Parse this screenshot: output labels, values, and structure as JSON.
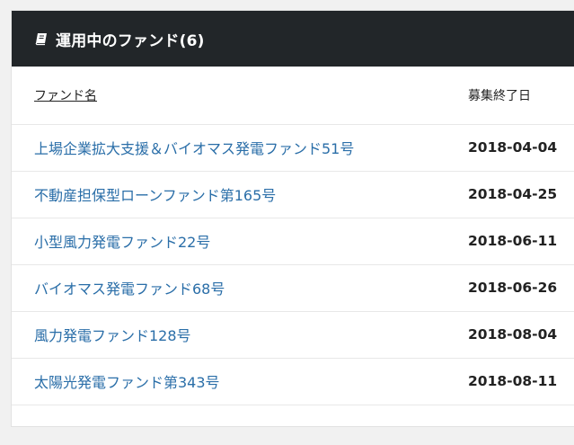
{
  "header": {
    "icon": "book-icon",
    "title": "運用中のファンド(6)"
  },
  "table": {
    "columns": {
      "name": "ファンド名",
      "date": "募集終了日"
    },
    "rows": [
      {
        "name": "上場企業拡大支援＆バイオマス発電ファンド51号",
        "date": "2018-04-04"
      },
      {
        "name": "不動産担保型ローンファンド第165号",
        "date": "2018-04-25"
      },
      {
        "name": "小型風力発電ファンド22号",
        "date": "2018-06-11"
      },
      {
        "name": "バイオマス発電ファンド68号",
        "date": "2018-06-26"
      },
      {
        "name": "風力発電ファンド128号",
        "date": "2018-08-04"
      },
      {
        "name": "太陽光発電ファンド第343号",
        "date": "2018-08-11"
      }
    ]
  },
  "colors": {
    "header_bg": "#222629",
    "link": "#2a6ea8"
  }
}
